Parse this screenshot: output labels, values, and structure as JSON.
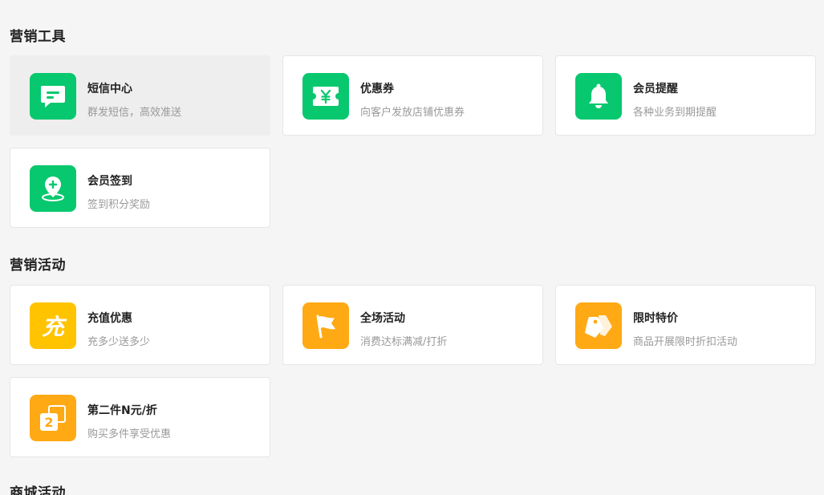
{
  "colors": {
    "green": "#07c86e",
    "yellow": "#ffc300",
    "orange": "#ffa914"
  },
  "marketing_tools": {
    "title": "营销工具",
    "items": [
      {
        "name": "短信中心",
        "desc": "群发短信，高效准送",
        "icon": "sms-chat-icon"
      },
      {
        "name": "优惠券",
        "desc": "向客户发放店铺优惠券",
        "icon": "coupon-yen-icon"
      },
      {
        "name": "会员提醒",
        "desc": "各种业务到期提醒",
        "icon": "bell-icon"
      },
      {
        "name": "会员签到",
        "desc": "签到积分奖励",
        "icon": "location-checkin-icon"
      }
    ]
  },
  "marketing_activities": {
    "title": "营销活动",
    "items": [
      {
        "name": "充值优惠",
        "desc": "充多少送多少",
        "icon": "recharge-icon",
        "icon_text": "充"
      },
      {
        "name": "全场活动",
        "desc": "消费达标满减/打折",
        "icon": "flag-icon"
      },
      {
        "name": "限时特价",
        "desc": "商品开展限时折扣活动",
        "icon": "price-tag-icon"
      },
      {
        "name": "第二件N元/折",
        "desc": "购买多件享受优惠",
        "icon": "second-item-icon",
        "icon_text": "2"
      }
    ]
  },
  "mall_activities": {
    "title": "商城活动"
  }
}
